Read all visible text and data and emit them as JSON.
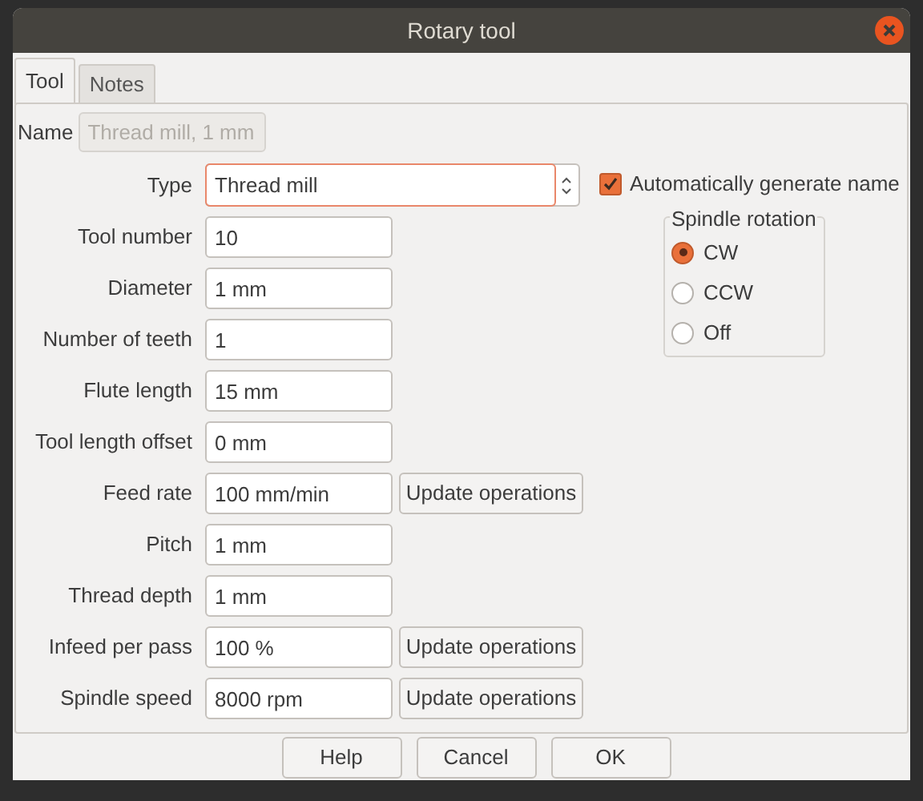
{
  "window": {
    "title": "Rotary tool"
  },
  "tabs": [
    {
      "label": "Tool",
      "selected": true
    },
    {
      "label": "Notes",
      "selected": false
    }
  ],
  "name": {
    "label": "Name",
    "value": "Thread mill, 1 mm",
    "disabled": true
  },
  "type": {
    "label": "Type",
    "value": "Thread mill"
  },
  "auto_name": {
    "label": "Automatically generate name",
    "checked": true
  },
  "fields": [
    {
      "label": "Tool number",
      "value": "10"
    },
    {
      "label": "Diameter",
      "value": "1 mm"
    },
    {
      "label": "Number of teeth",
      "value": "1"
    },
    {
      "label": "Flute length",
      "value": "15 mm"
    },
    {
      "label": "Tool length offset",
      "value": "0 mm"
    },
    {
      "label": "Feed rate",
      "value": "100 mm/min",
      "button": "Update operations"
    },
    {
      "label": "Pitch",
      "value": "1 mm"
    },
    {
      "label": "Thread depth",
      "value": "1 mm"
    },
    {
      "label": "Infeed per pass",
      "value": "100 %",
      "button": "Update operations"
    },
    {
      "label": "Spindle speed",
      "value": "8000 rpm",
      "button": "Update operations"
    }
  ],
  "spindle_rotation": {
    "title": "Spindle rotation",
    "options": [
      {
        "label": "CW",
        "selected": true
      },
      {
        "label": "CCW",
        "selected": false
      },
      {
        "label": "Off",
        "selected": false
      }
    ]
  },
  "buttons": [
    "Help",
    "Cancel",
    "OK"
  ]
}
